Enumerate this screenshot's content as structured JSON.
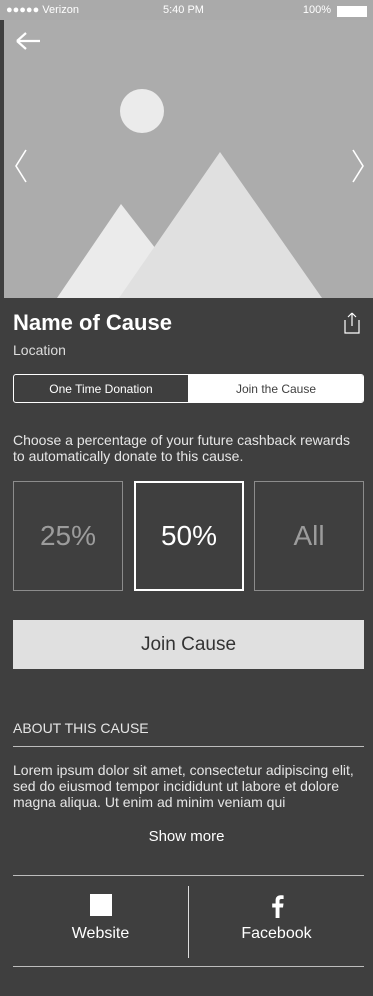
{
  "status_bar": {
    "carrier": "●●●●● Verizon",
    "time": "5:40 PM",
    "battery": "100%"
  },
  "cause": {
    "name": "Name of Cause",
    "location": "Location"
  },
  "donation_tabs": [
    {
      "label": "One Time Donation",
      "active": false
    },
    {
      "label": "Join the Cause",
      "active": true
    }
  ],
  "description": "Choose a percentage of your future cashback rewards to automatically donate to this cause.",
  "options": [
    {
      "label": "25%",
      "selected": false
    },
    {
      "label": "50%",
      "selected": true
    },
    {
      "label": "All",
      "selected": false
    }
  ],
  "join_button": "Join Cause",
  "about": {
    "heading": "ABOUT THIS CAUSE",
    "text": "Lorem ipsum dolor sit amet, consectetur adipiscing elit, sed do eiusmod tempor incididunt ut labore et dolore magna aliqua. Ut enim ad minim veniam qui",
    "show_more": "Show more"
  },
  "links": {
    "website": "Website",
    "facebook": "Facebook"
  },
  "icons": {
    "back": "arrow-left-icon",
    "prev": "chevron-left-icon",
    "next": "chevron-right-icon",
    "share": "share-icon",
    "website": "website-icon",
    "facebook": "facebook-icon"
  }
}
